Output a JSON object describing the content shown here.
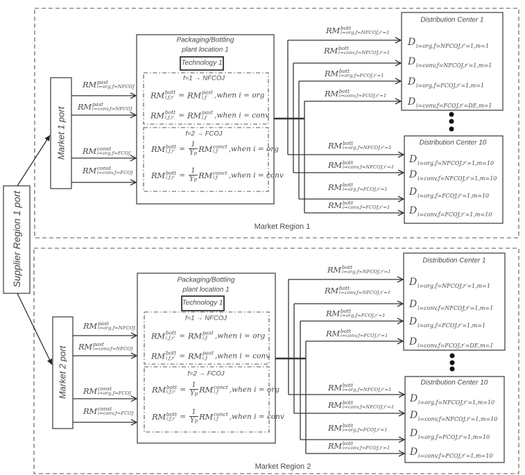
{
  "supplier": {
    "label": "Supplier Region 1 port"
  },
  "regions": [
    {
      "label": "Market Region 1",
      "market_port": "Market 1 port",
      "inputs": [
        {
          "base": "RM",
          "sup": "past",
          "sub": "i=org,f=NFCOJ"
        },
        {
          "base": "RM",
          "sup": "past",
          "sub": "i=conv,f=NFCOJ"
        },
        {
          "base": "RM",
          "sup": "const",
          "sub": "i=org,f=FCOJ"
        },
        {
          "base": "RM",
          "sup": "const",
          "sub": "i=conv,f=FCOJ"
        }
      ],
      "plant": {
        "title_line1": "Packaging/Bottling",
        "title_line2": "plant location 1",
        "technology": "Technology 1",
        "groups": [
          {
            "header": "f=1 → NFCOJ",
            "equations": [
              {
                "lhs": {
                  "base": "RM",
                  "sup": "bott",
                  "sub": "i,f,r′"
                },
                "equals": "=",
                "rhs": {
                  "base": "RM",
                  "sup": "past",
                  "sub": "i,f"
                },
                "condition": ",when i = org"
              },
              {
                "lhs": {
                  "base": "RM",
                  "sup": "bott",
                  "sub": "i,f,r′"
                },
                "equals": "=",
                "rhs": {
                  "base": "RM",
                  "sup": "past",
                  "sub": "i,f"
                },
                "condition": ",when i = conv"
              }
            ]
          },
          {
            "header": "f=2 → FCOJ",
            "equations": [
              {
                "lhs": {
                  "base": "RM",
                  "sup": "bott",
                  "sub": "i,f,r′"
                },
                "equals": "=",
                "frac": {
                  "num": "1",
                  "den": "Y",
                  "den_sub": "p"
                },
                "rhs": {
                  "base": "RM",
                  "sup": "conct",
                  "sub": "i,f"
                },
                "condition": ",when i = org"
              },
              {
                "lhs": {
                  "base": "RM",
                  "sup": "bott",
                  "sub": "i,f,r′"
                },
                "equals": "=",
                "frac": {
                  "num": "1",
                  "den": "Y",
                  "den_sub": "p"
                },
                "rhs": {
                  "base": "RM",
                  "sup": "conct",
                  "sub": "i,f"
                },
                "condition": ",when i = conv"
              }
            ]
          }
        ]
      },
      "outputs": [
        {
          "base": "RM",
          "sup": "bott",
          "sub": "i=org,f=NFCOJ,r′=1"
        },
        {
          "base": "RM",
          "sup": "bott",
          "sub": "i=conv,f=NFCOJ,r′=1"
        },
        {
          "base": "RM",
          "sup": "bott",
          "sub": "i=org,f=FCOJ,r′=1"
        },
        {
          "base": "RM",
          "sup": "bott",
          "sub": "i=conv,f=FCOJ,r′=1"
        },
        {
          "base": "RM",
          "sup": "bott",
          "sub": "i=org,f=NFCOJ,r′=1"
        },
        {
          "base": "RM",
          "sup": "bott",
          "sub": "i=conv,f=NFCOJ,r′=1"
        },
        {
          "base": "RM",
          "sup": "bott",
          "sub": "i=org,f=FCOJ,r′=1"
        },
        {
          "base": "RM",
          "sup": "bott",
          "sub": "i=conv,f=FCOJ,r′=1"
        }
      ],
      "distribution_centers": [
        {
          "title": "Distribution Center 1",
          "rows": [
            {
              "base": "D",
              "sub": "i=org,f=NFCOJ,r′=1,m=1"
            },
            {
              "base": "D",
              "sub": "i=conv,f=NFCOJ,r′=1,m=1"
            },
            {
              "base": "D",
              "sub": "i=org,f=FCOJ,r′=1,m=1"
            },
            {
              "base": "D",
              "sub": "i=conv,f=FCOJ,r′=DE,m=1"
            }
          ]
        },
        {
          "title": "Distribution Center 10",
          "rows": [
            {
              "base": "D",
              "sub": "i=org,f=NFCOJ,r′=1,m=10"
            },
            {
              "base": "D",
              "sub": "i=conv,f=NFCOJ,r′=1,m=10"
            },
            {
              "base": "D",
              "sub": "i=org,f=FCOJ,r′=1,m=10"
            },
            {
              "base": "D",
              "sub": "i=conv,f=FCOJ,r′=1,m=10"
            }
          ]
        }
      ]
    },
    {
      "label": "Market Region 2",
      "market_port": "Market 2 port",
      "inputs": [
        {
          "base": "RM",
          "sup": "past",
          "sub": "i=org,f=NFCOJ"
        },
        {
          "base": "RM",
          "sup": "past",
          "sub": "i=conv,f=NFCOJ"
        },
        {
          "base": "RM",
          "sup": "const",
          "sub": "i=org,f=FCOJ"
        },
        {
          "base": "RM",
          "sup": "const",
          "sub": "i=conv,f=FCOJ"
        }
      ],
      "plant": {
        "title_line1": "Packaging/Bottling",
        "title_line2": "plant location 1",
        "technology": "Technology 1",
        "groups": [
          {
            "header": "f=1 → NFCOJ",
            "equations": [
              {
                "lhs": {
                  "base": "RM",
                  "sup": "bott",
                  "sub": "i,f,r′"
                },
                "equals": "=",
                "rhs": {
                  "base": "RM",
                  "sup": "past",
                  "sub": "i,f"
                },
                "condition": ",when i = org"
              },
              {
                "lhs": {
                  "base": "RM",
                  "sup": "bott",
                  "sub": "i,f,r′"
                },
                "equals": "=",
                "rhs": {
                  "base": "RM",
                  "sup": "past",
                  "sub": "i,f"
                },
                "condition": ",when i = conv"
              }
            ]
          },
          {
            "header": "f=2 → FCOJ",
            "equations": [
              {
                "lhs": {
                  "base": "RM",
                  "sup": "bott",
                  "sub": "i,f,r′"
                },
                "equals": "=",
                "frac": {
                  "num": "1",
                  "den": "Y",
                  "den_sub": "p"
                },
                "rhs": {
                  "base": "RM",
                  "sup": "conct",
                  "sub": "i,f"
                },
                "condition": ",when i = org"
              },
              {
                "lhs": {
                  "base": "RM",
                  "sup": "bott",
                  "sub": "i,f,r′"
                },
                "equals": "=",
                "frac": {
                  "num": "1",
                  "den": "Y",
                  "den_sub": "p"
                },
                "rhs": {
                  "base": "RM",
                  "sup": "conct",
                  "sub": "i,f"
                },
                "condition": ",when i = conv"
              }
            ]
          }
        ]
      },
      "outputs": [
        {
          "base": "RM",
          "sup": "bott",
          "sub": "i=org,f=NFCOJ,r′=1"
        },
        {
          "base": "RM",
          "sup": "bott",
          "sub": "i=conv,f=NFCOJ,r′=1"
        },
        {
          "base": "RM",
          "sup": "bott",
          "sub": "i=org,f=FCOJ,r′=1"
        },
        {
          "base": "RM",
          "sup": "bott",
          "sub": "i=conv,f=FCOJ,r′=1"
        },
        {
          "base": "RM",
          "sup": "bott",
          "sub": "i=org,f=NFCOJ,r′=1"
        },
        {
          "base": "RM",
          "sup": "bott",
          "sub": "i=conv,f=NFCOJ,r′=1"
        },
        {
          "base": "RM",
          "sup": "bott",
          "sub": "i=org,f=FCOJ,r′=1"
        },
        {
          "base": "RM",
          "sup": "bott",
          "sub": "i=conv,f=FCOJ,r′=1"
        }
      ],
      "distribution_centers": [
        {
          "title": "Distribution Center 1",
          "rows": [
            {
              "base": "D",
              "sub": "i=org,f=NFCOJ,r′=1,m=1"
            },
            {
              "base": "D",
              "sub": "i=conv,f=NFCOJ,r′=1,m=1"
            },
            {
              "base": "D",
              "sub": "i=org,f=FCOJ,r′=1,m=1"
            },
            {
              "base": "D",
              "sub": "i=conv,f=FCOJ,r′=DE,m=1"
            }
          ]
        },
        {
          "title": "Distribution Center 10",
          "rows": [
            {
              "base": "D",
              "sub": "i=org,f=NFCOJ,r′=1,m=10"
            },
            {
              "base": "D",
              "sub": "i=conv,f=NFCOJ,r′=1,m=10"
            },
            {
              "base": "D",
              "sub": "i=org,f=FCOJ,r′=1,m=10"
            },
            {
              "base": "D",
              "sub": "i=conv,f=FCOJ,r′=1,m=10"
            }
          ]
        }
      ]
    }
  ]
}
